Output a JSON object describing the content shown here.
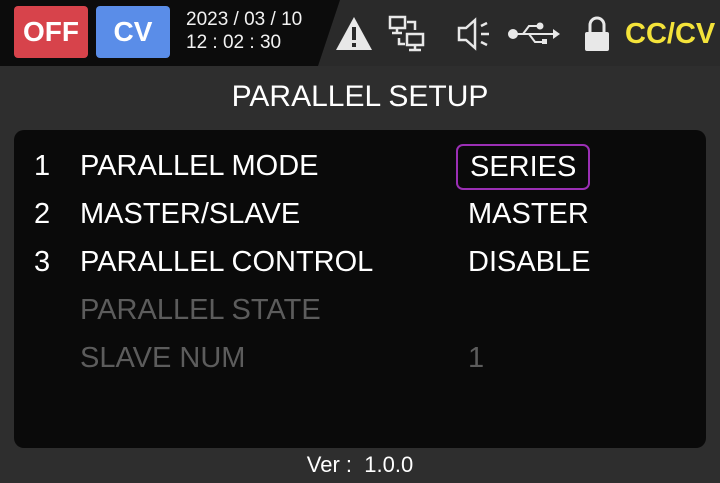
{
  "status_bar": {
    "output_state": "OFF",
    "mode": "CV",
    "date": "2023 / 03 / 10",
    "time": "12 : 02 : 30",
    "mode_indicator": "CC/CV",
    "icons": [
      "warning-icon",
      "remote-interface-icon",
      "speaker-icon",
      "usb-icon",
      "lock-icon"
    ],
    "colors": {
      "off_badge": "#d7434b",
      "cv_badge": "#5a8de8",
      "mode_indicator": "#f4e33a"
    }
  },
  "page": {
    "title": "PARALLEL SETUP"
  },
  "settings": {
    "rows": [
      {
        "num": "1",
        "label": "PARALLEL MODE",
        "value": "SERIES",
        "selected": true,
        "enabled": true
      },
      {
        "num": "2",
        "label": "MASTER/SLAVE",
        "value": "MASTER",
        "selected": false,
        "enabled": true
      },
      {
        "num": "3",
        "label": "PARALLEL CONTROL",
        "value": "DISABLE",
        "selected": false,
        "enabled": true
      },
      {
        "num": "",
        "label": "PARALLEL STATE",
        "value": "",
        "selected": false,
        "enabled": false
      },
      {
        "num": "",
        "label": "SLAVE NUM",
        "value": "1",
        "selected": false,
        "enabled": false
      }
    ],
    "selection_color": "#9b2fb5"
  },
  "footer": {
    "version": "Ver :  1.0.0"
  }
}
